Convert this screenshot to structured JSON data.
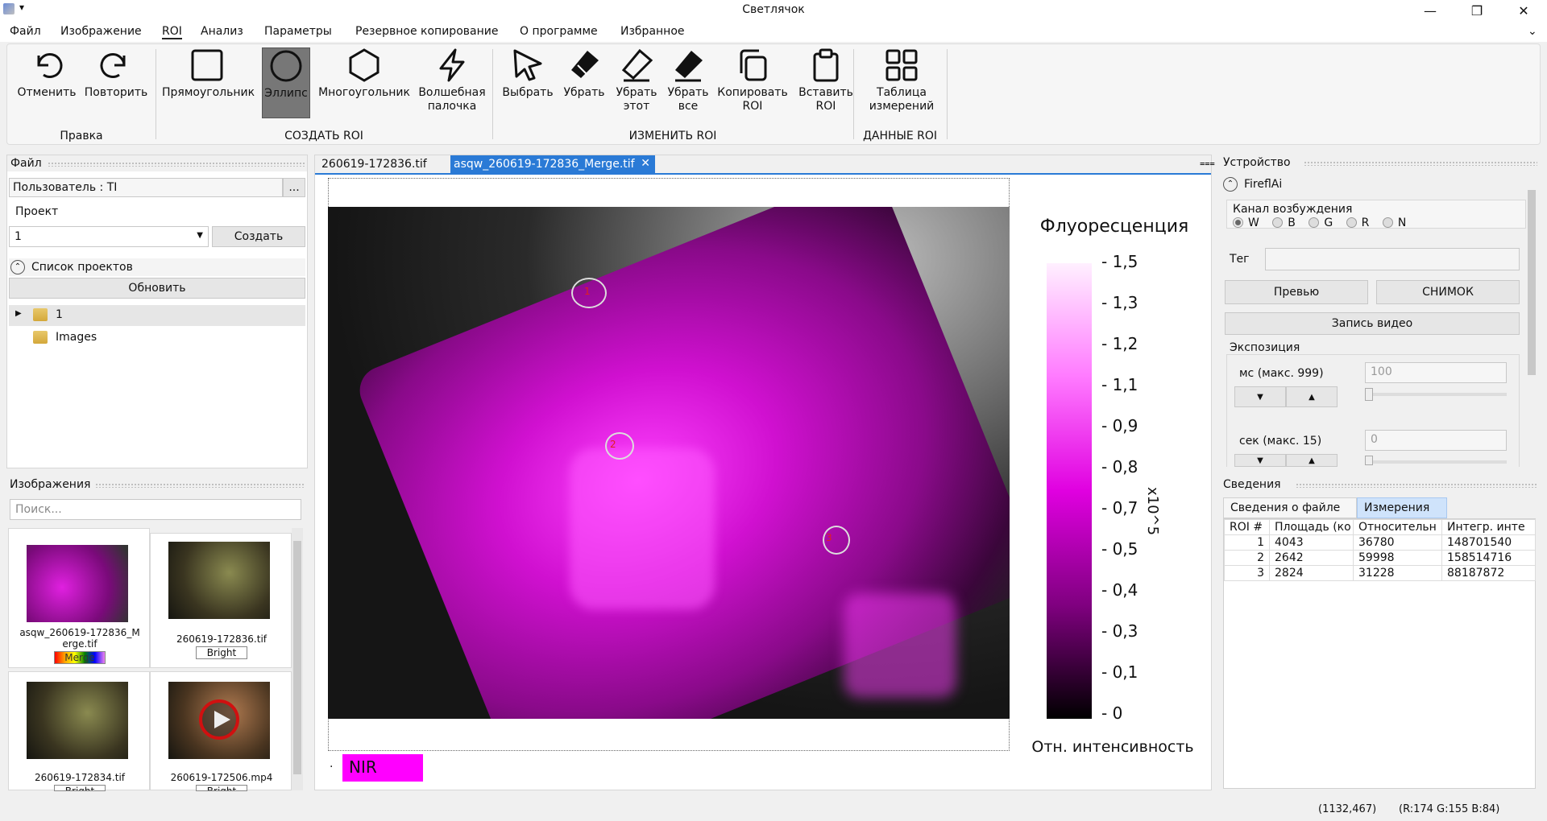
{
  "window": {
    "title": "Светлячок",
    "minimize": "—",
    "maximize": "❐",
    "close": "✕"
  },
  "menu": [
    "Файл",
    "Изображение",
    "ROI",
    "Анализ",
    "Параметры",
    "Резервное копирование",
    "О программе",
    "Избранное"
  ],
  "ribbon": {
    "undo": "Отменить",
    "redo": "Повторить",
    "rect": "Прямоугольник",
    "ellipse": "Эллипс",
    "polygon": "Многоугольник",
    "wand1": "Волшебная",
    "wand2": "палочка",
    "select": "Выбрать",
    "remove": "Убрать",
    "remove_this1": "Убрать",
    "remove_this2": "этот",
    "remove_all1": "Убрать",
    "remove_all2": "все",
    "copy1": "Копировать",
    "copy2": "ROI",
    "paste1": "Вставить",
    "paste2": "ROI",
    "table1": "Таблица",
    "table2": "измерений",
    "groups": {
      "edit": "Правка",
      "create": "СОЗДАТЬ ROI",
      "modify": "ИЗМЕНИТЬ ROI",
      "data": "ДАННЫЕ ROI"
    }
  },
  "file_panel": {
    "header": "Файл",
    "user": "Пользователь : TI",
    "user_btn": "...",
    "project_label": "Проект",
    "project_value": "1",
    "create_btn": "Создать",
    "project_list": "Список проектов",
    "refresh": "Обновить",
    "tree": [
      {
        "label": "1"
      },
      {
        "label": "Images"
      }
    ]
  },
  "images_panel": {
    "header": "Изображения",
    "search_placeholder": "Поиск...",
    "items": [
      {
        "name": "asqw_260619-172836_M",
        "name2": "erge.tif",
        "tag": "Merge"
      },
      {
        "name": "260619-172836.tif",
        "tag": "Bright"
      },
      {
        "name": "260619-172834.tif",
        "tag": "Bright"
      },
      {
        "name": "260619-172506.mp4",
        "tag": "Bright"
      }
    ]
  },
  "viewer": {
    "tabs": [
      {
        "label": "260619-172836.tif"
      },
      {
        "label": "asqw_260619-172836_Merge.tif"
      }
    ],
    "colorbar_title": "Флуоресценция",
    "colorbar_ticks": [
      "1,5",
      "1,3",
      "1,2",
      "1,1",
      "0,9",
      "0,8",
      "0,7",
      "0,5",
      "0,4",
      "0,3",
      "0,1",
      "0"
    ],
    "colorbar_unit": "x10^5",
    "colorbar_label": "Отн. интенсивность",
    "channel": "NIR",
    "rois": [
      {
        "id": "1"
      },
      {
        "id": "2"
      },
      {
        "id": "3"
      }
    ]
  },
  "device_panel": {
    "header": "Устройство",
    "device": "FireflAi",
    "excitation_label": "Канал возбуждения",
    "channels": [
      "W",
      "B",
      "G",
      "R",
      "N"
    ],
    "selected_channel": "W",
    "tag_label": "Тег",
    "preview": "Превью",
    "snapshot": "СНИМОК",
    "record": "Запись видео",
    "exposure_label": "Экспозиция",
    "ms_label": "мс (макс. 999)",
    "ms_value": "100",
    "sec_label": "сек (макс. 15)",
    "sec_value": "0"
  },
  "info_panel": {
    "header": "Сведения",
    "tabs": [
      "Сведения о файле",
      "Измерения"
    ],
    "columns": [
      "ROI #",
      "Площадь (ко",
      "Относительн",
      "Интегр. инте"
    ],
    "rows": [
      {
        "n": "1",
        "area": "4043",
        "rel": "36780",
        "integ": "148701540"
      },
      {
        "n": "2",
        "area": "2642",
        "rel": "59998",
        "integ": "158514716"
      },
      {
        "n": "3",
        "area": "2824",
        "rel": "31228",
        "integ": "88187872"
      }
    ]
  },
  "status": {
    "coords": "(1132,467)",
    "rgb": "(R:174 G:155 B:84)"
  }
}
